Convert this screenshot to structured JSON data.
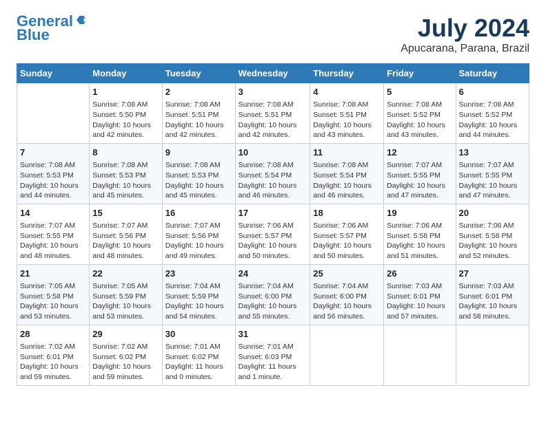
{
  "header": {
    "logo_line1": "General",
    "logo_line2": "Blue",
    "title": "July 2024",
    "subtitle": "Apucarana, Parana, Brazil"
  },
  "days_of_week": [
    "Sunday",
    "Monday",
    "Tuesday",
    "Wednesday",
    "Thursday",
    "Friday",
    "Saturday"
  ],
  "weeks": [
    [
      {
        "day": "",
        "info": ""
      },
      {
        "day": "1",
        "info": "Sunrise: 7:08 AM\nSunset: 5:50 PM\nDaylight: 10 hours\nand 42 minutes."
      },
      {
        "day": "2",
        "info": "Sunrise: 7:08 AM\nSunset: 5:51 PM\nDaylight: 10 hours\nand 42 minutes."
      },
      {
        "day": "3",
        "info": "Sunrise: 7:08 AM\nSunset: 5:51 PM\nDaylight: 10 hours\nand 42 minutes."
      },
      {
        "day": "4",
        "info": "Sunrise: 7:08 AM\nSunset: 5:51 PM\nDaylight: 10 hours\nand 43 minutes."
      },
      {
        "day": "5",
        "info": "Sunrise: 7:08 AM\nSunset: 5:52 PM\nDaylight: 10 hours\nand 43 minutes."
      },
      {
        "day": "6",
        "info": "Sunrise: 7:08 AM\nSunset: 5:52 PM\nDaylight: 10 hours\nand 44 minutes."
      }
    ],
    [
      {
        "day": "7",
        "info": "Sunrise: 7:08 AM\nSunset: 5:53 PM\nDaylight: 10 hours\nand 44 minutes."
      },
      {
        "day": "8",
        "info": "Sunrise: 7:08 AM\nSunset: 5:53 PM\nDaylight: 10 hours\nand 45 minutes."
      },
      {
        "day": "9",
        "info": "Sunrise: 7:08 AM\nSunset: 5:53 PM\nDaylight: 10 hours\nand 45 minutes."
      },
      {
        "day": "10",
        "info": "Sunrise: 7:08 AM\nSunset: 5:54 PM\nDaylight: 10 hours\nand 46 minutes."
      },
      {
        "day": "11",
        "info": "Sunrise: 7:08 AM\nSunset: 5:54 PM\nDaylight: 10 hours\nand 46 minutes."
      },
      {
        "day": "12",
        "info": "Sunrise: 7:07 AM\nSunset: 5:55 PM\nDaylight: 10 hours\nand 47 minutes."
      },
      {
        "day": "13",
        "info": "Sunrise: 7:07 AM\nSunset: 5:55 PM\nDaylight: 10 hours\nand 47 minutes."
      }
    ],
    [
      {
        "day": "14",
        "info": "Sunrise: 7:07 AM\nSunset: 5:55 PM\nDaylight: 10 hours\nand 48 minutes."
      },
      {
        "day": "15",
        "info": "Sunrise: 7:07 AM\nSunset: 5:56 PM\nDaylight: 10 hours\nand 48 minutes."
      },
      {
        "day": "16",
        "info": "Sunrise: 7:07 AM\nSunset: 5:56 PM\nDaylight: 10 hours\nand 49 minutes."
      },
      {
        "day": "17",
        "info": "Sunrise: 7:06 AM\nSunset: 5:57 PM\nDaylight: 10 hours\nand 50 minutes."
      },
      {
        "day": "18",
        "info": "Sunrise: 7:06 AM\nSunset: 5:57 PM\nDaylight: 10 hours\nand 50 minutes."
      },
      {
        "day": "19",
        "info": "Sunrise: 7:06 AM\nSunset: 5:58 PM\nDaylight: 10 hours\nand 51 minutes."
      },
      {
        "day": "20",
        "info": "Sunrise: 7:06 AM\nSunset: 5:58 PM\nDaylight: 10 hours\nand 52 minutes."
      }
    ],
    [
      {
        "day": "21",
        "info": "Sunrise: 7:05 AM\nSunset: 5:58 PM\nDaylight: 10 hours\nand 53 minutes."
      },
      {
        "day": "22",
        "info": "Sunrise: 7:05 AM\nSunset: 5:59 PM\nDaylight: 10 hours\nand 53 minutes."
      },
      {
        "day": "23",
        "info": "Sunrise: 7:04 AM\nSunset: 5:59 PM\nDaylight: 10 hours\nand 54 minutes."
      },
      {
        "day": "24",
        "info": "Sunrise: 7:04 AM\nSunset: 6:00 PM\nDaylight: 10 hours\nand 55 minutes."
      },
      {
        "day": "25",
        "info": "Sunrise: 7:04 AM\nSunset: 6:00 PM\nDaylight: 10 hours\nand 56 minutes."
      },
      {
        "day": "26",
        "info": "Sunrise: 7:03 AM\nSunset: 6:01 PM\nDaylight: 10 hours\nand 57 minutes."
      },
      {
        "day": "27",
        "info": "Sunrise: 7:03 AM\nSunset: 6:01 PM\nDaylight: 10 hours\nand 58 minutes."
      }
    ],
    [
      {
        "day": "28",
        "info": "Sunrise: 7:02 AM\nSunset: 6:01 PM\nDaylight: 10 hours\nand 59 minutes."
      },
      {
        "day": "29",
        "info": "Sunrise: 7:02 AM\nSunset: 6:02 PM\nDaylight: 10 hours\nand 59 minutes."
      },
      {
        "day": "30",
        "info": "Sunrise: 7:01 AM\nSunset: 6:02 PM\nDaylight: 11 hours\nand 0 minutes."
      },
      {
        "day": "31",
        "info": "Sunrise: 7:01 AM\nSunset: 6:03 PM\nDaylight: 11 hours\nand 1 minute."
      },
      {
        "day": "",
        "info": ""
      },
      {
        "day": "",
        "info": ""
      },
      {
        "day": "",
        "info": ""
      }
    ]
  ]
}
